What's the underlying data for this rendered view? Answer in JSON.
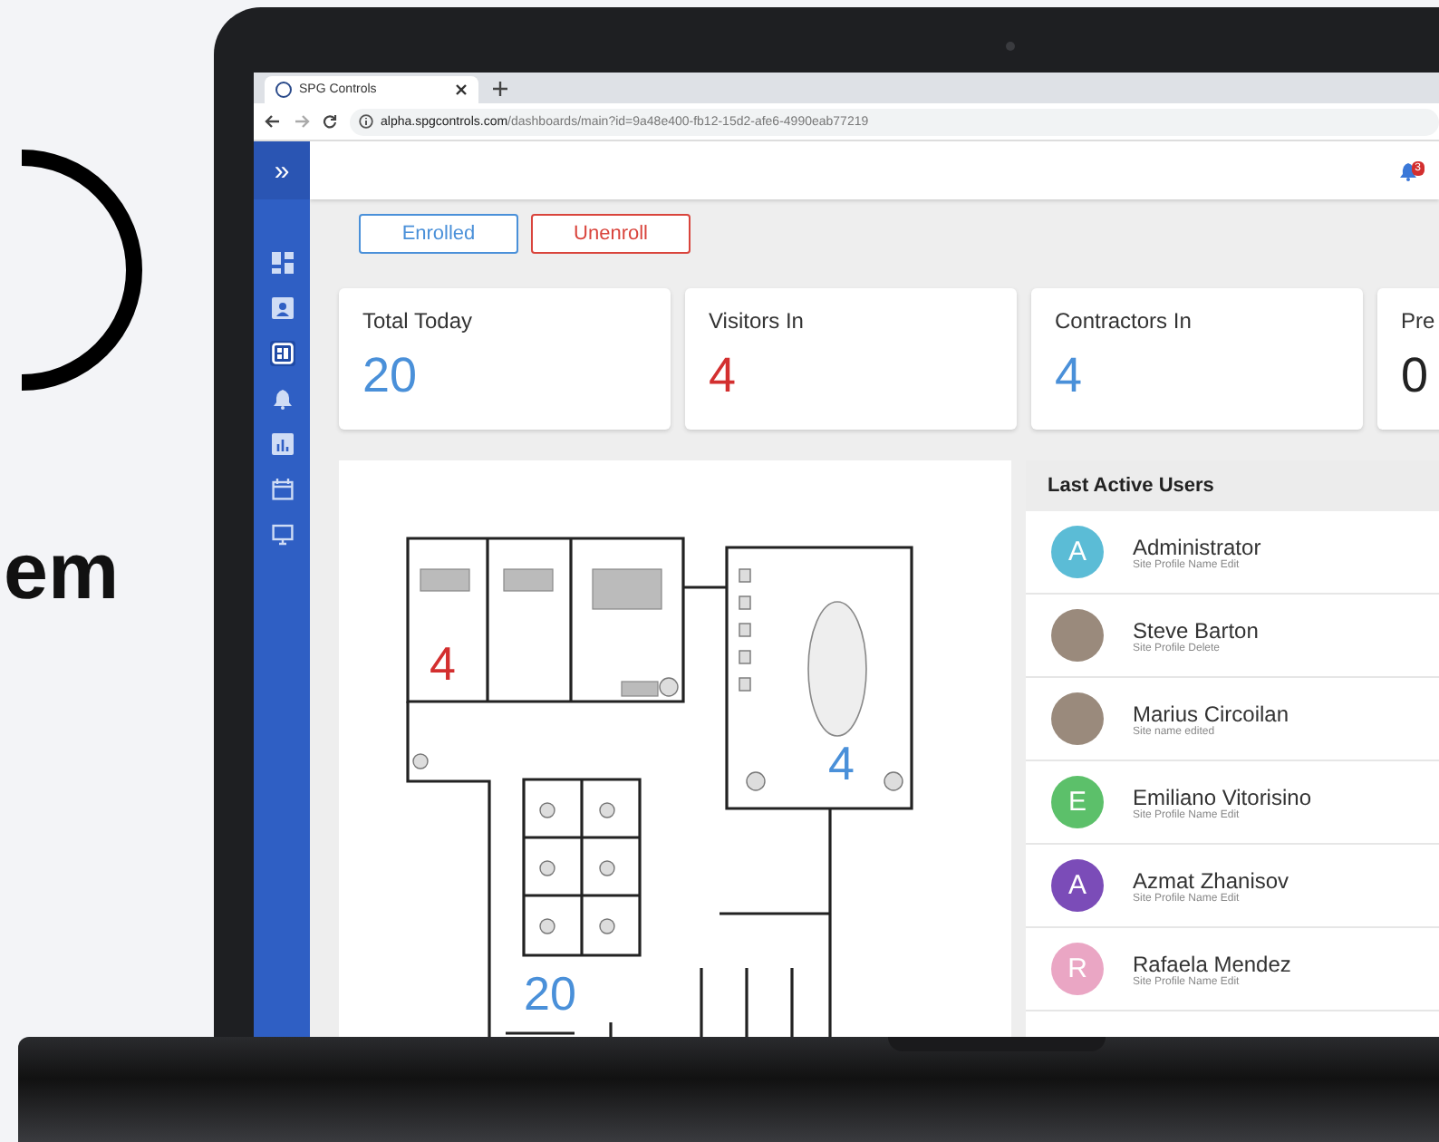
{
  "promo": {
    "text": "em"
  },
  "browser": {
    "tab_title": "SPG Controls",
    "url_host": "alpha.spgcontrols.com",
    "url_path": "/dashboards/main?id=9a48e400-fb12-15d2-afe6-4990eab77219"
  },
  "sidebar": {
    "toggle": "»",
    "items": [
      {
        "selected": false
      },
      {
        "selected": false
      },
      {
        "selected": true
      },
      {
        "selected": false
      },
      {
        "selected": false
      },
      {
        "selected": false
      },
      {
        "selected": false
      }
    ]
  },
  "header": {
    "notifications": "3"
  },
  "actions": [
    {
      "label": "Enrolled",
      "color": "#4a90d9"
    },
    {
      "label": "Unenroll",
      "color": "#d9443c"
    }
  ],
  "stats": [
    {
      "label": "Total Today",
      "value": "20",
      "color": "#4a90d9"
    },
    {
      "label": "Visitors In",
      "value": "4",
      "color": "#d32f2f"
    },
    {
      "label": "Contractors In",
      "value": "4",
      "color": "#4a90d9"
    },
    {
      "label": "Pre",
      "value": "0",
      "color": "#222222"
    }
  ],
  "floor_plan": {
    "zones": [
      {
        "count": "4",
        "color": "#d32f2f"
      },
      {
        "count": "4",
        "color": "#4a90d9"
      },
      {
        "count": "20",
        "color": "#4a90d9"
      }
    ]
  },
  "users_panel": {
    "title": "Last Active Users",
    "users": [
      {
        "name": "Administrator",
        "detail": "Site Profile Name Edit",
        "avatar": {
          "kind": "letter",
          "letter": "A",
          "color": "#5bbcd6"
        }
      },
      {
        "name": "Steve Barton",
        "detail": "Site Profile Delete",
        "avatar": {
          "kind": "photo"
        }
      },
      {
        "name": "Marius Circoilan",
        "detail": "Site name edited",
        "avatar": {
          "kind": "photo"
        }
      },
      {
        "name": "Emiliano Vitorisino",
        "detail": "Site Profile Name Edit",
        "avatar": {
          "kind": "letter",
          "letter": "E",
          "color": "#5cc06a"
        }
      },
      {
        "name": "Azmat Zhanisov",
        "detail": "Site Profile Name Edit",
        "avatar": {
          "kind": "letter",
          "letter": "A",
          "color": "#7b4cb8"
        }
      },
      {
        "name": "Rafaela Mendez",
        "detail": "Site Profile Name Edit",
        "avatar": {
          "kind": "letter",
          "letter": "R",
          "color": "#eaa6c4"
        }
      }
    ]
  }
}
